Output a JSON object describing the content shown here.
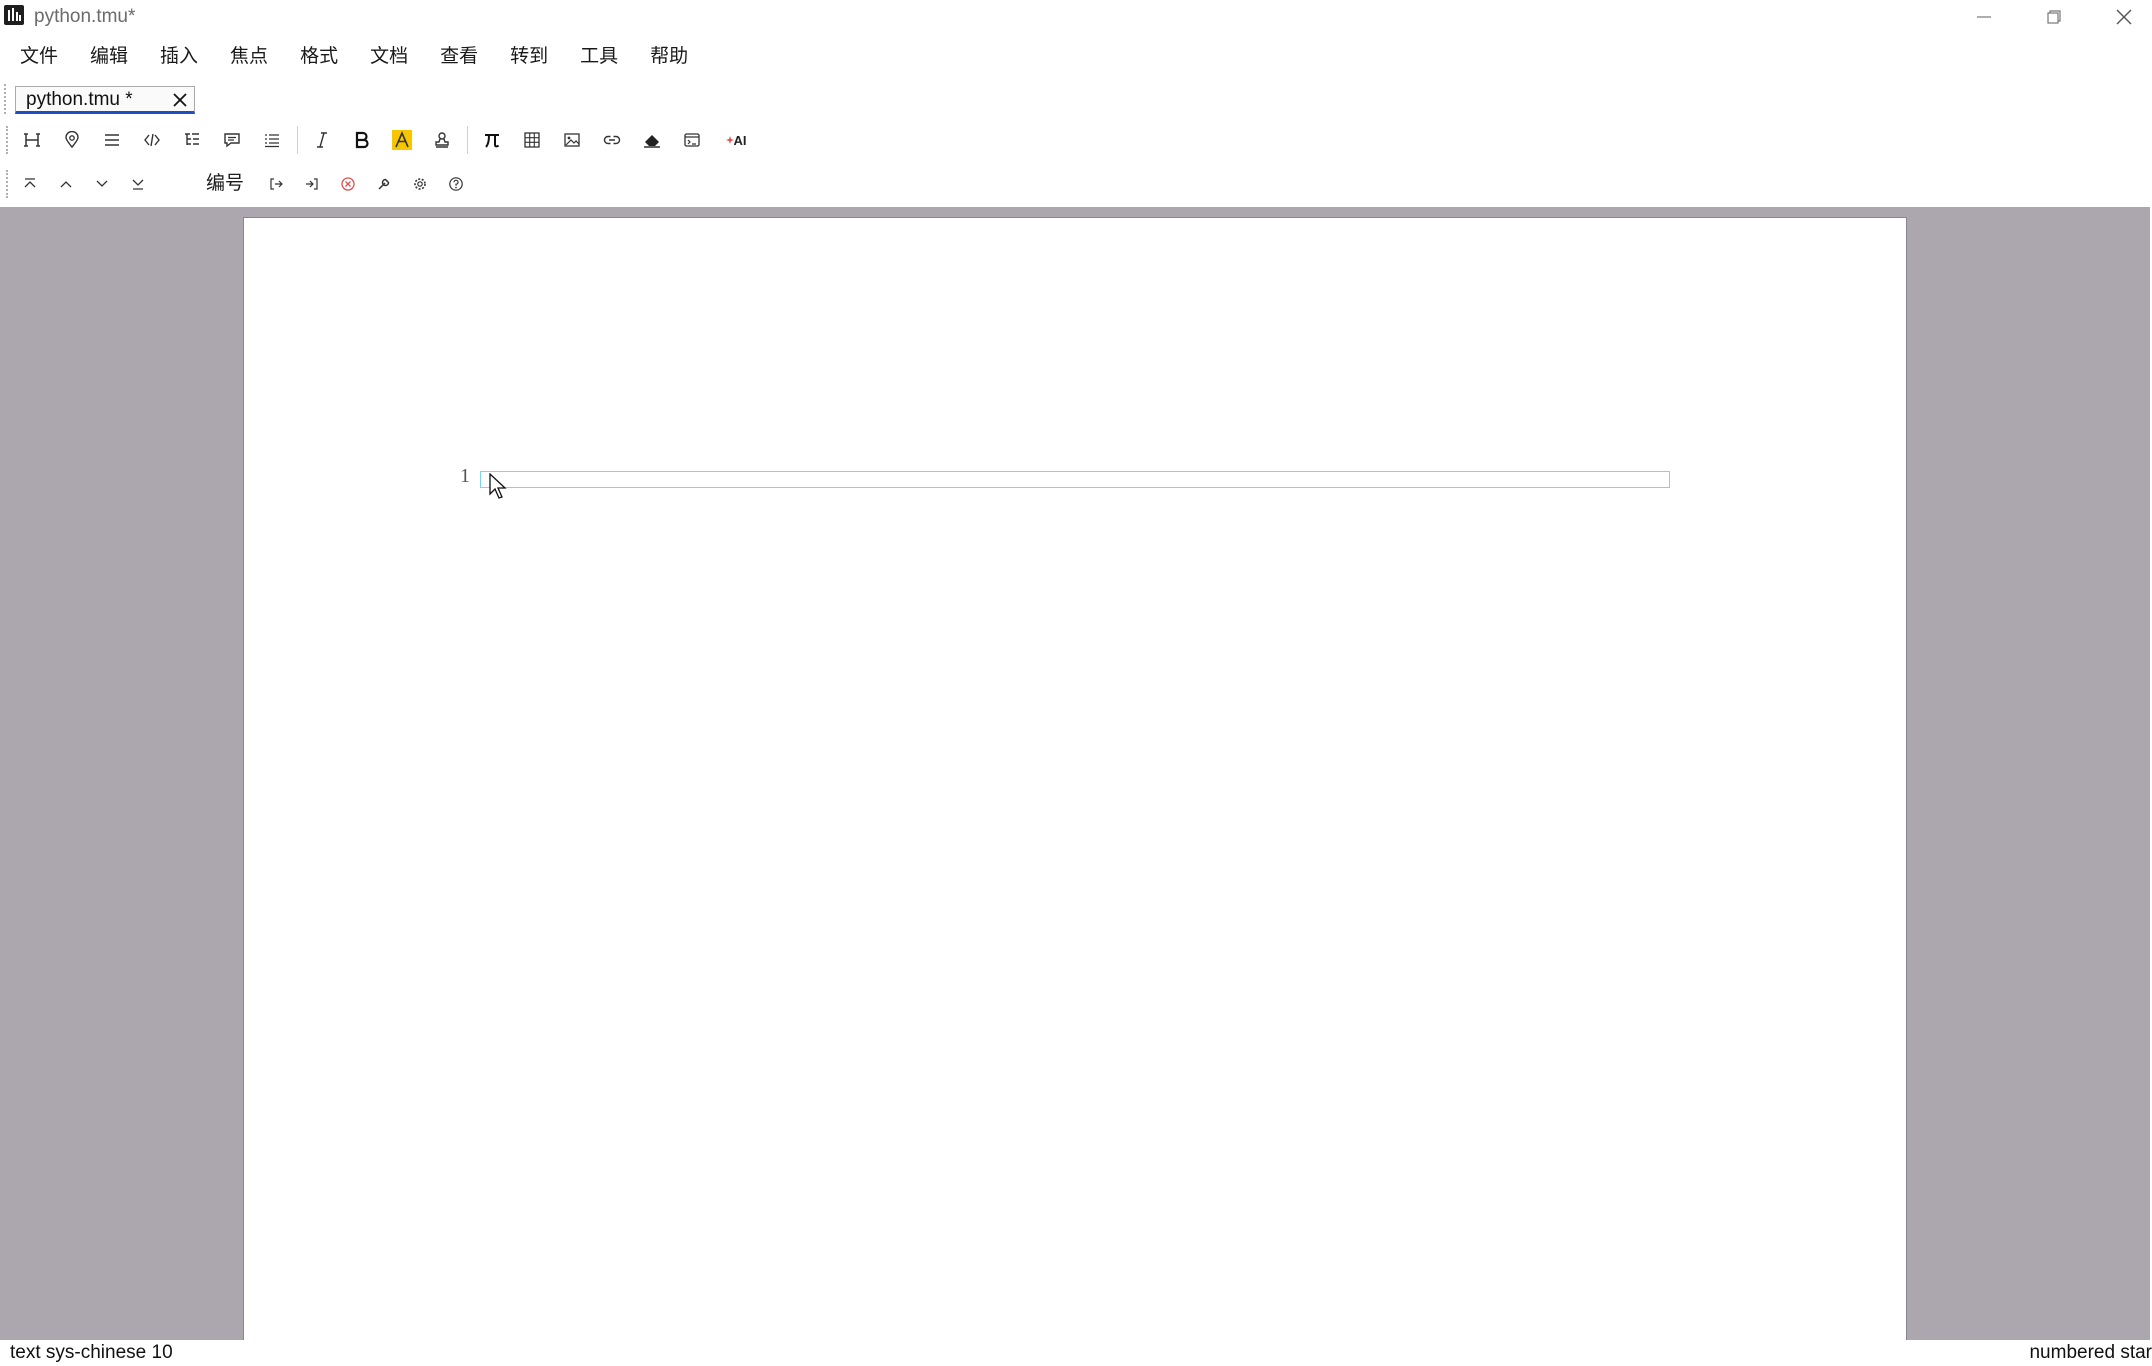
{
  "window": {
    "title": "python.tmu*",
    "controls": [
      "minimize-icon",
      "maximize-icon",
      "close-icon"
    ]
  },
  "menubar": {
    "items": [
      "文件",
      "编辑",
      "插入",
      "焦点",
      "格式",
      "文档",
      "查看",
      "转到",
      "工具",
      "帮助"
    ]
  },
  "tabs": [
    {
      "label": "python.tmu *",
      "active": true
    }
  ],
  "toolbar1": {
    "icons": [
      "heading-icon",
      "focus-pin-icon",
      "paragraph-icon",
      "code-icon",
      "outline-tree-icon",
      "comment-icon",
      "list-icon",
      "italic-icon",
      "bold-icon",
      "highlight-icon",
      "stamp-icon",
      "formula-pi-icon",
      "table-icon",
      "image-icon",
      "link-icon",
      "eraser-icon",
      "terminal-window-icon",
      "ai-icon"
    ],
    "ai_label": "AI"
  },
  "toolbar2": {
    "icons": [
      "move-top-icon",
      "move-up-icon",
      "move-down-icon",
      "move-bottom-icon",
      "export-icon",
      "import-icon",
      "cancel-circle-icon",
      "wrench-icon",
      "gear-icon",
      "help-circle-icon"
    ],
    "numbering_label": "编号"
  },
  "document": {
    "line_number": "1"
  },
  "statusbar": {
    "left": "text sys-chinese 10",
    "right": "numbered star"
  },
  "colors": {
    "workspace_bg": "#aca6ae",
    "highlight_yellow": "#f7c600",
    "cancel_red": "#d9534f",
    "edit_line_border": "#7fd4e8",
    "tab_underline": "#1f4fbf"
  }
}
